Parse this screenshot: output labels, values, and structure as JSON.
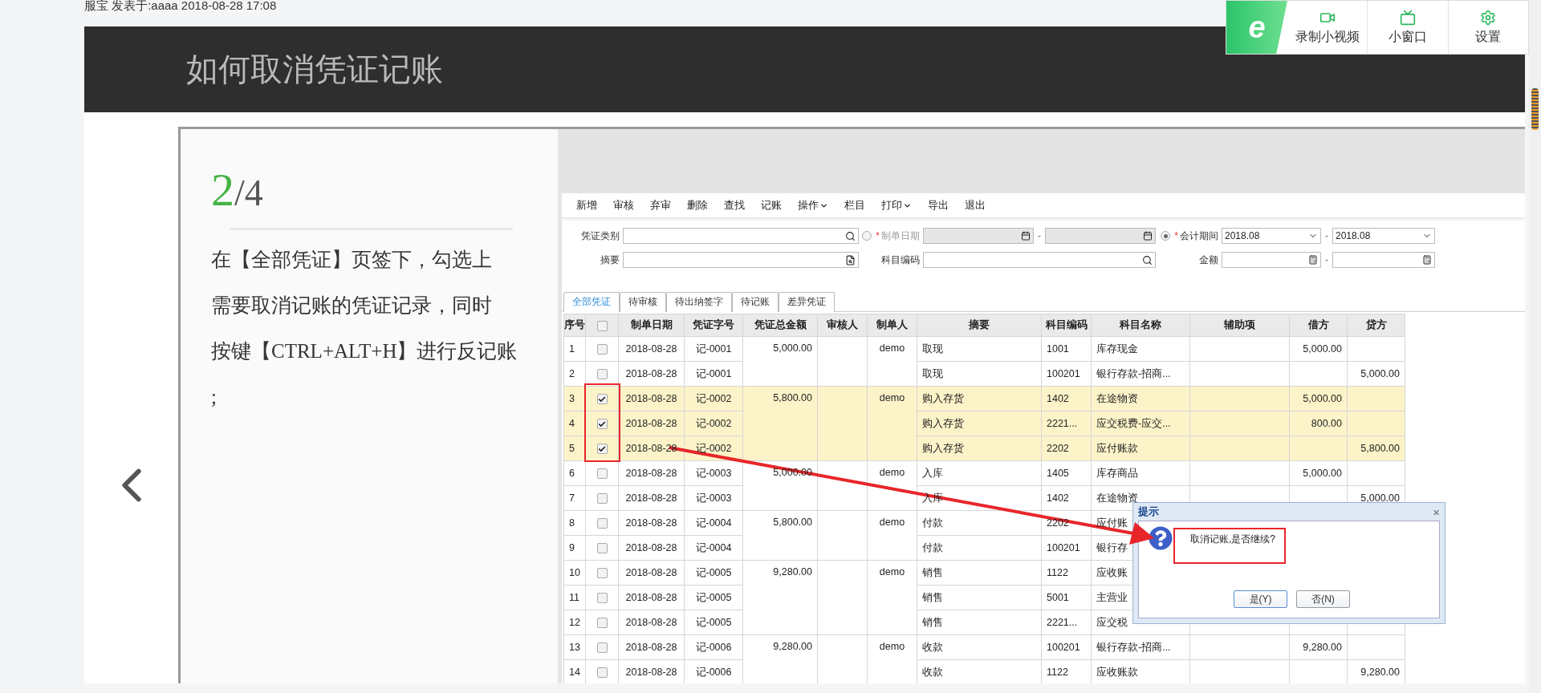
{
  "post_meta": "服宝 发表于:aaaa 2018-08-28 17:08",
  "header": {
    "title": "如何取消凭证记账"
  },
  "widget": {
    "logo": "e",
    "buttons": [
      {
        "label": "录制小视频",
        "kind": "video"
      },
      {
        "label": "小窗口",
        "kind": "tv"
      },
      {
        "label": "设置",
        "kind": "settings"
      }
    ]
  },
  "slide": {
    "step_current": "2",
    "step_total": "/4",
    "instruction_lines": [
      "在【全部凭证】页签下，勾选上",
      "需要取消记账的凭证记录，同时",
      "按键【CTRL+ALT+H】进行反记账",
      ";"
    ]
  },
  "app": {
    "toolbar": [
      {
        "label": "新增",
        "dropdown": false
      },
      {
        "label": "审核",
        "dropdown": false
      },
      {
        "label": "弃审",
        "dropdown": false
      },
      {
        "label": "删除",
        "dropdown": false
      },
      {
        "label": "查找",
        "dropdown": false
      },
      {
        "label": "记账",
        "dropdown": false
      },
      {
        "label": "操作",
        "dropdown": true
      },
      {
        "label": "栏目",
        "dropdown": false
      },
      {
        "label": "打印",
        "dropdown": true
      },
      {
        "label": "导出",
        "dropdown": false
      },
      {
        "label": "退出",
        "dropdown": false
      }
    ],
    "filters": {
      "voucher_type": {
        "label": "凭证类别"
      },
      "date": {
        "label": "制单日期",
        "required_mark": "*",
        "selected": false,
        "range_sep": "-"
      },
      "period": {
        "label": "会计期间",
        "required_mark": "*",
        "selected": true,
        "from": "2018.08",
        "to": "2018.08",
        "range_sep": "-"
      },
      "summary": {
        "label": "摘要"
      },
      "account_code": {
        "label": "科目编码"
      },
      "amount": {
        "label": "金额",
        "range_sep": "-"
      }
    },
    "tabs": [
      {
        "label": "全部凭证",
        "selected": true
      },
      {
        "label": "待审核",
        "selected": false
      },
      {
        "label": "待出纳签字",
        "selected": false
      },
      {
        "label": "待记账",
        "selected": false
      },
      {
        "label": "差异凭证",
        "selected": false
      }
    ],
    "table": {
      "columns": [
        "序号",
        "",
        "制单日期",
        "凭证字号",
        "凭证总金额",
        "审核人",
        "制单人",
        "摘要",
        "科目编码",
        "科目名称",
        "辅助项",
        "借方",
        "贷方"
      ],
      "header_checked": false,
      "vouchers": [
        {
          "amount": "5,000.00",
          "maker": "demo",
          "rows": [
            {
              "no": "1",
              "checked": false,
              "date": "2018-08-28",
              "voucher_no": "记-0001",
              "summary": "取现",
              "code": "1001",
              "name": "库存现金",
              "debit": "5,000.00"
            },
            {
              "no": "2",
              "checked": false,
              "date": "2018-08-28",
              "voucher_no": "记-0001",
              "summary": "取现",
              "code": "100201",
              "name": "银行存款-招商...",
              "credit": "5,000.00"
            }
          ]
        },
        {
          "amount": "5,800.00",
          "maker": "demo",
          "rows": [
            {
              "no": "3",
              "checked": true,
              "date": "2018-08-28",
              "voucher_no": "记-0002",
              "summary": "购入存货",
              "code": "1402",
              "name": "在途物资",
              "debit": "5,000.00"
            },
            {
              "no": "4",
              "checked": true,
              "date": "2018-08-28",
              "voucher_no": "记-0002",
              "summary": "购入存货",
              "code": "2221...",
              "name": "应交税费-应交...",
              "debit": "800.00"
            },
            {
              "no": "5",
              "checked": true,
              "date": "2018-08-28",
              "voucher_no": "记-0002",
              "summary": "购入存货",
              "code": "2202",
              "name": "应付账款",
              "credit": "5,800.00"
            }
          ]
        },
        {
          "amount": "5,000.00",
          "maker": "demo",
          "rows": [
            {
              "no": "6",
              "checked": false,
              "date": "2018-08-28",
              "voucher_no": "记-0003",
              "summary": "入库",
              "code": "1405",
              "name": "库存商品",
              "debit": "5,000.00"
            },
            {
              "no": "7",
              "checked": false,
              "date": "2018-08-28",
              "voucher_no": "记-0003",
              "summary": "入库",
              "code": "1402",
              "name": "在途物资",
              "credit": "5,000.00"
            }
          ]
        },
        {
          "amount": "5,800.00",
          "maker": "demo",
          "rows": [
            {
              "no": "8",
              "checked": false,
              "date": "2018-08-28",
              "voucher_no": "记-0004",
              "summary": "付款",
              "code": "2202",
              "name": "应付账"
            },
            {
              "no": "9",
              "checked": false,
              "date": "2018-08-28",
              "voucher_no": "记-0004",
              "summary": "付款",
              "code": "100201",
              "name": "银行存"
            }
          ]
        },
        {
          "amount": "9,280.00",
          "maker": "demo",
          "rows": [
            {
              "no": "10",
              "checked": false,
              "date": "2018-08-28",
              "voucher_no": "记-0005",
              "summary": "销售",
              "code": "1122",
              "name": "应收账"
            },
            {
              "no": "11",
              "checked": false,
              "date": "2018-08-28",
              "voucher_no": "记-0005",
              "summary": "销售",
              "code": "5001",
              "name": "主营业"
            },
            {
              "no": "12",
              "checked": false,
              "date": "2018-08-28",
              "voucher_no": "记-0005",
              "summary": "销售",
              "code": "2221...",
              "name": "应交税"
            }
          ]
        },
        {
          "amount": "9,280.00",
          "maker": "demo",
          "rows": [
            {
              "no": "13",
              "checked": false,
              "date": "2018-08-28",
              "voucher_no": "记-0006",
              "summary": "收款",
              "code": "100201",
              "name": "银行存款-招商...",
              "debit": "9,280.00"
            },
            {
              "no": "14",
              "checked": false,
              "date": "2018-08-28",
              "voucher_no": "记-0006",
              "summary": "收款",
              "code": "1122",
              "name": "应收账款",
              "credit": "9,280.00"
            }
          ]
        }
      ]
    },
    "dialog": {
      "title": "提示",
      "close": "×",
      "message": "取消记账,是否继续?",
      "buttons": [
        {
          "label": "是(Y)",
          "focused": true
        },
        {
          "label": "否(N)",
          "focused": false
        }
      ]
    }
  }
}
